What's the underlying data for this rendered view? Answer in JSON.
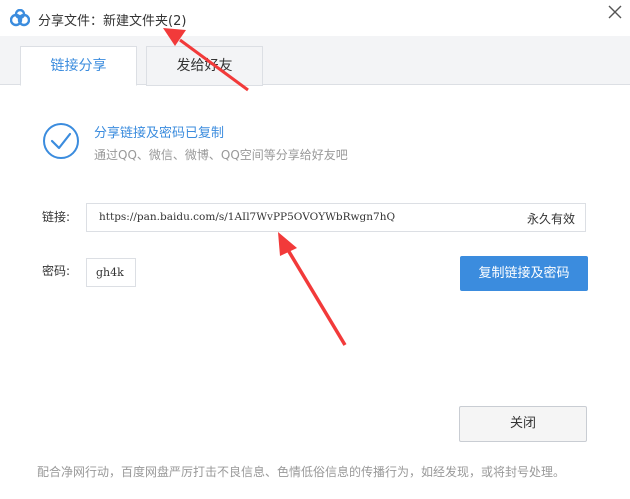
{
  "window": {
    "title": "分享文件：新建文件夹(2)",
    "close_glyph": "✕"
  },
  "tabs": [
    {
      "label": "链接分享",
      "active": true
    },
    {
      "label": "发给好友",
      "active": false
    }
  ],
  "status": {
    "title": "分享链接及密码已复制",
    "subtitle": "通过QQ、微信、微博、QQ空间等分享给好友吧"
  },
  "link": {
    "label": "链接:",
    "url": "https://pan.baidu.com/s/1AIl7WvPP5OVOYWbRwgn7hQ",
    "validity": "永久有效"
  },
  "password": {
    "label": "密码:",
    "value": "gh4k"
  },
  "buttons": {
    "copy": "复制链接及密码",
    "close": "关闭"
  },
  "footer": {
    "note": "配合净网行动，百度网盘严厉打击不良信息、色情低俗信息的传播行为，如经发现，或将封号处理。"
  },
  "colors": {
    "accent": "#3b8cde",
    "annotation_arrow": "#f23a3a"
  },
  "icons": {
    "app": "baidu-netdisk-logo-icon",
    "status": "check-circle-icon",
    "close": "close-icon"
  }
}
